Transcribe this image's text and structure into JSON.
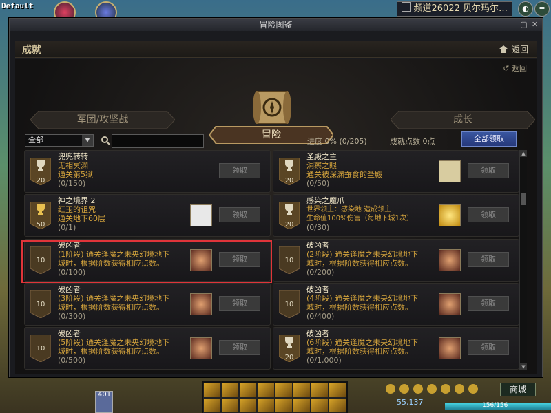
{
  "top": {
    "profile_label": "Default",
    "channel_text": "频道26022 贝尔玛尔…"
  },
  "window": {
    "title": "冒险图鉴",
    "header_title": "成就",
    "back_label": "返回",
    "sub_back_label": "返回"
  },
  "tabs": [
    {
      "label": "军团/攻坚战"
    },
    {
      "label": "冒险"
    },
    {
      "label": "成长"
    }
  ],
  "filter": {
    "selected": "全部",
    "search_value": "",
    "progress_text": "进度  0%  (0/205)",
    "points_text": "成就点数 0点",
    "claim_all_label": "全部领取"
  },
  "achievements": [
    {
      "points": "20",
      "trophy": true,
      "title": "兜兜转转",
      "desc": "无相冥渊\n通关第5狱",
      "progress": "(0/150)",
      "reward_icon": "",
      "claim_label": "领取"
    },
    {
      "points": "20",
      "trophy": true,
      "title": "圣殿之主",
      "desc": "洞察之眼\n通关被深渊蚕食的圣殿",
      "progress": "(0/50)",
      "reward_icon": "map-icon",
      "claim_label": "领取"
    },
    {
      "points": "50",
      "trophy": true,
      "title": "神之境界 2",
      "desc": "红玉的诅咒\n通关地下60层",
      "progress": "(0/1)",
      "reward_icon": "scroll-icon",
      "claim_label": "领取"
    },
    {
      "points": "20",
      "trophy": true,
      "title": "感染之魔爪",
      "desc": "世界领主：感染地        造成领主\n生命值100%伤害（每地下城1次）",
      "progress": "(0/30)",
      "reward_icon": "star-burst-icon",
      "claim_label": "领取"
    },
    {
      "points": "10",
      "trophy": false,
      "title": "破凶者",
      "desc": "(1阶段) 通关逢魔之未央幻境地下\n城时，根据阶数获得相应点数。",
      "progress": "(0/100)",
      "reward_icon": "emblem-icon",
      "claim_label": "领取"
    },
    {
      "points": "10",
      "trophy": false,
      "title": "破凶者",
      "desc": "(2阶段) 通关逢魔之未央幻境地下\n城时，根据阶数获得相应点数。",
      "progress": "(0/200)",
      "reward_icon": "emblem-icon",
      "claim_label": "领取"
    },
    {
      "points": "10",
      "trophy": false,
      "title": "破凶者",
      "desc": "(3阶段) 通关逢魔之未央幻境地下\n城时，根据阶数获得相应点数。",
      "progress": "(0/300)",
      "reward_icon": "emblem-icon",
      "claim_label": "领取"
    },
    {
      "points": "10",
      "trophy": false,
      "title": "破凶者",
      "desc": "(4阶段) 通关逢魔之未央幻境地下\n城时，根据阶数获得相应点数。",
      "progress": "(0/400)",
      "reward_icon": "emblem-icon",
      "claim_label": "领取"
    },
    {
      "points": "10",
      "trophy": false,
      "title": "破凶者",
      "desc": "(5阶段) 通关逢魔之未央幻境地下\n城时，根据阶数获得相应点数。",
      "progress": "(0/500)",
      "reward_icon": "emblem-icon",
      "claim_label": "领取"
    },
    {
      "points": "20",
      "trophy": true,
      "title": "破凶者",
      "desc": "(6阶段) 通关逢魔之未央幻境地下\n城时，根据阶数获得相应点数。",
      "progress": "(0/1,000)",
      "reward_icon": "emblem-icon",
      "claim_label": "领取"
    }
  ],
  "hud": {
    "level_text": "401",
    "money_text": "55,137",
    "hp_text": "156/156",
    "hp_fraction": 1.0,
    "shop_label": "商城"
  },
  "colors": {
    "accent_gold": "#d2a23c",
    "highlight_red": "#e0343a",
    "claim_all_blue": "#3a56a0"
  }
}
